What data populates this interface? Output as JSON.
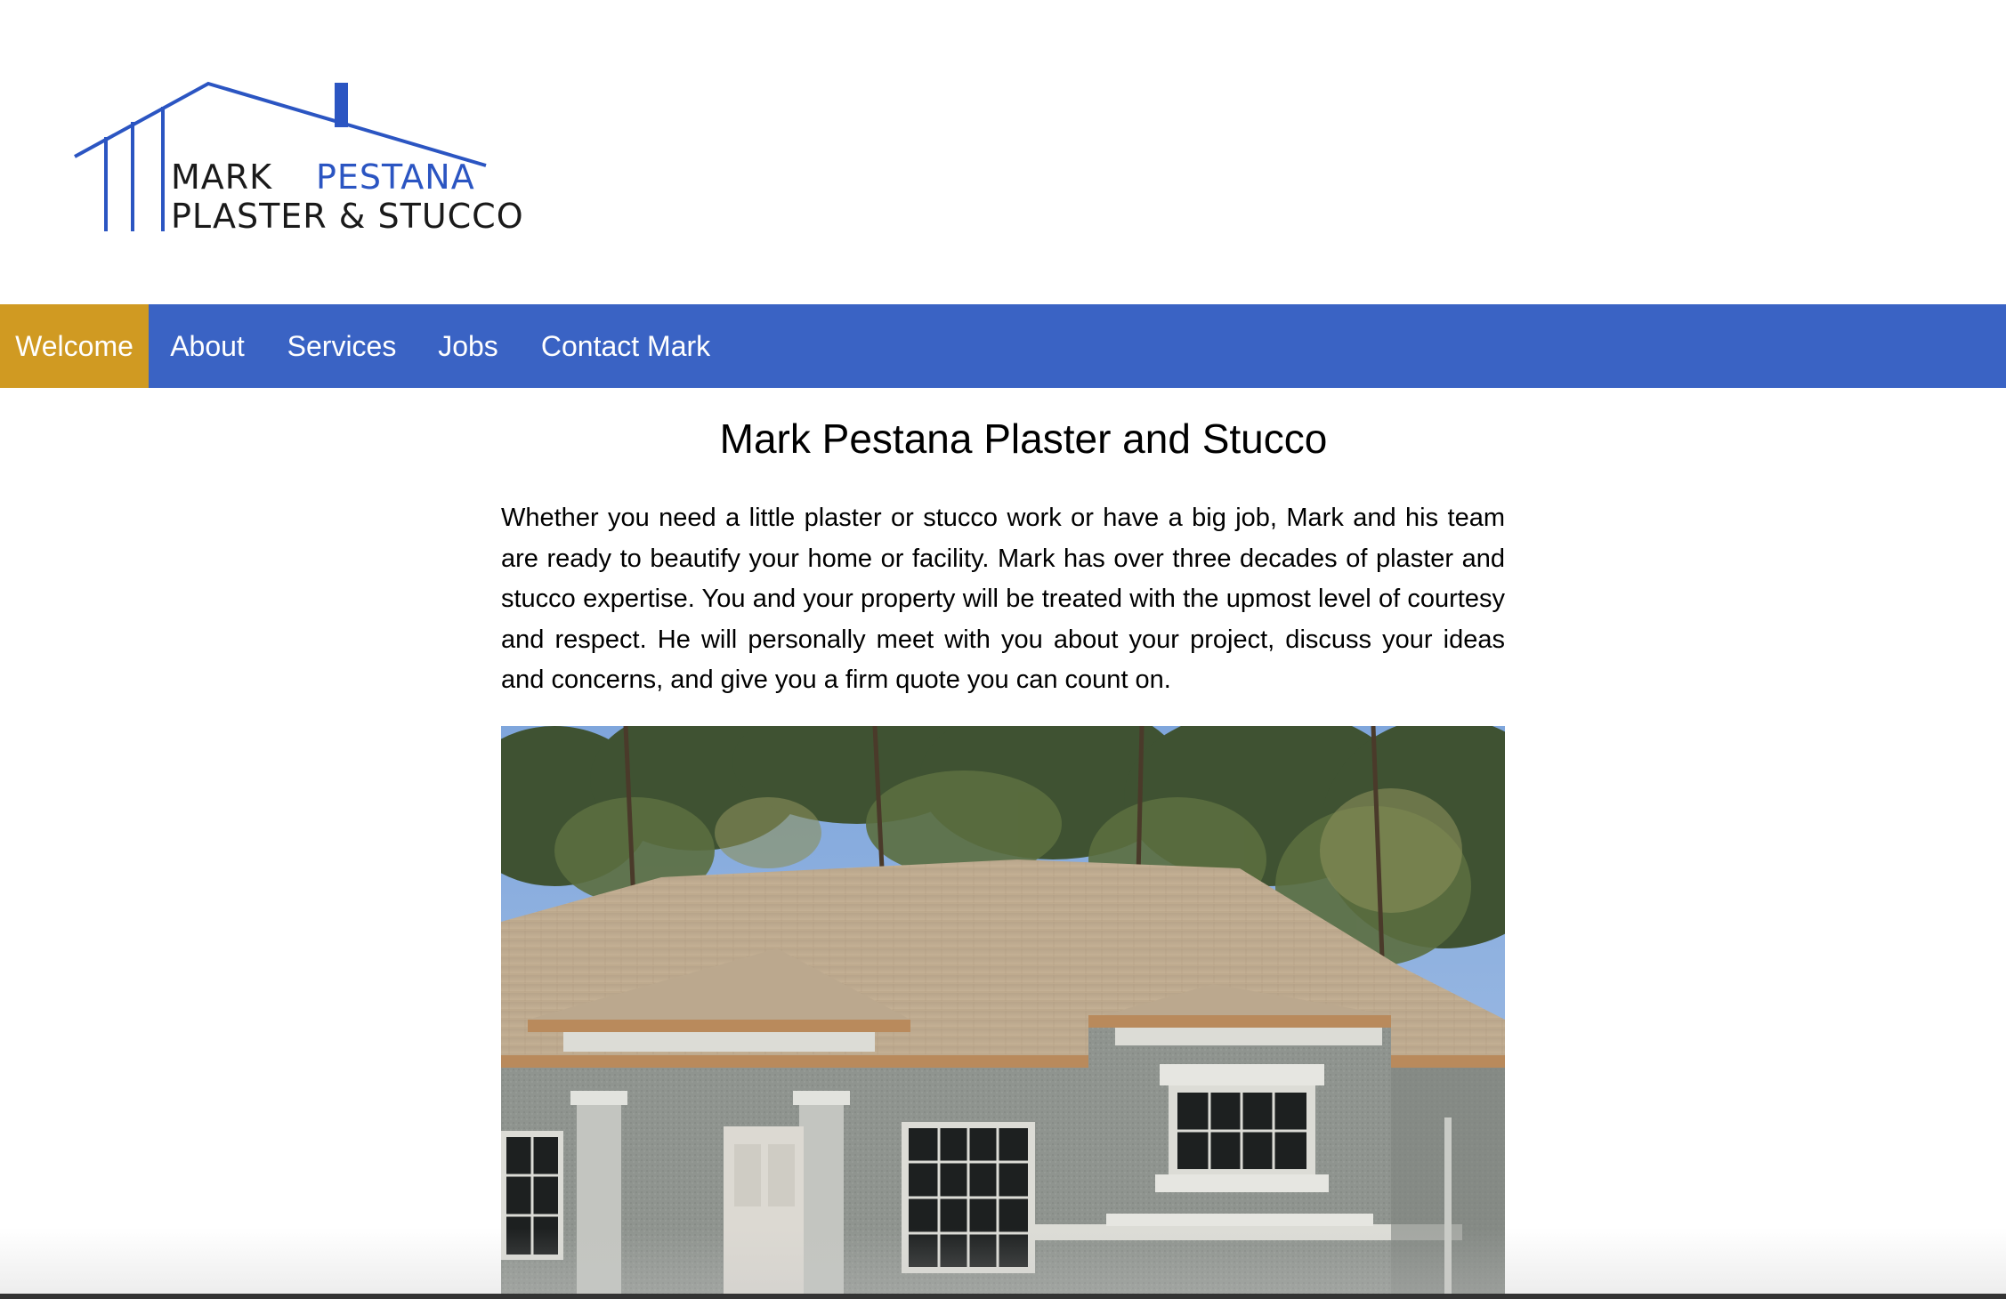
{
  "brand": {
    "line1_word1": "MARK",
    "line1_word2": "PESTANA",
    "line2": "PLASTER & STUCCO",
    "primary_color": "#2b55c2",
    "text_color": "#1a1a1a"
  },
  "nav": {
    "items": [
      {
        "label": "Welcome",
        "active": true
      },
      {
        "label": "About",
        "active": false
      },
      {
        "label": "Services",
        "active": false
      },
      {
        "label": "Jobs",
        "active": false
      },
      {
        "label": "Contact Mark",
        "active": false
      }
    ],
    "bar_color": "#3a63c4",
    "active_color": "#d09a22"
  },
  "main": {
    "title": "Mark Pestana Plaster and Stucco",
    "intro": "Whether you need a little plaster or stucco work or have a big job, Mark and his team are ready to beautify your home or facility. Mark has over three decades of plaster and stucco expertise. You and your property will be treated with the upmost level of courtesy and respect. He will personally meet with you about your project, discuss your ideas and concerns, and give you a firm quote you can count on."
  }
}
